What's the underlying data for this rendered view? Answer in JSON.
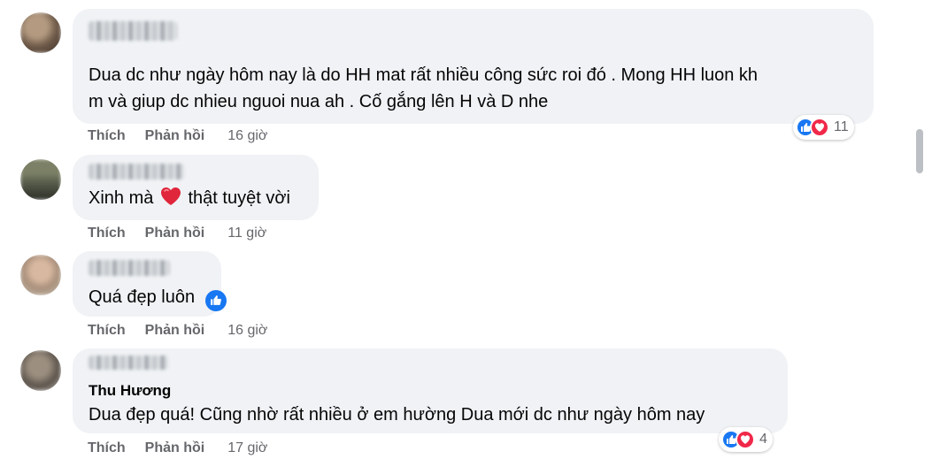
{
  "comments": [
    {
      "text_lines": [
        "Dua dc như ngày hôm nay là do HH mat rất nhiều công sức roi đó . Mong HH luon kh",
        "m và giup dc nhieu nguoi nua ah . Cố gắng lên H và D nhe"
      ],
      "like_label": "Thích",
      "reply_label": "Phản hồi",
      "time": "16 giờ",
      "reaction_count": "11"
    },
    {
      "text_before": "Xinh mà",
      "text_after": "thật tuyệt vời",
      "like_label": "Thích",
      "reply_label": "Phản hồi",
      "time": "11 giờ"
    },
    {
      "text": "Quá đẹp luôn",
      "like_label": "Thích",
      "reply_label": "Phản hồi",
      "time": "16 giờ"
    },
    {
      "subname": "Thu Hương",
      "text": "Dua đẹp quá! Cũng nhờ rất nhiều ở em hường Dua mới dc như ngày hôm nay",
      "like_label": "Thích",
      "reply_label": "Phản hồi",
      "time": "17 giờ",
      "reaction_count": "4"
    }
  ],
  "colors": {
    "bubble": "#f0f2f5",
    "like": "#1877f2",
    "love": "#f02849",
    "meta": "#65676b"
  }
}
